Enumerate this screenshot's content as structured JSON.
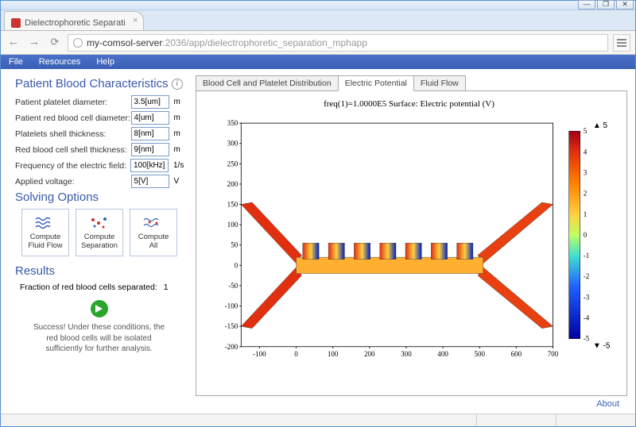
{
  "window": {
    "tab_title": "Dielectrophoretic Separati",
    "url_host": "my-comsol-server",
    "url_port": ":2036",
    "url_path": "/app/dielectrophoretic_separation_mphapp"
  },
  "menubar": [
    "File",
    "Resources",
    "Help"
  ],
  "sections": {
    "characteristics_title": "Patient Blood Characteristics",
    "solving_title": "Solving Options",
    "results_title": "Results"
  },
  "fields": [
    {
      "label": "Patient platelet diameter:",
      "value": "3.5[um]",
      "unit": "m"
    },
    {
      "label": "Patient red blood cell diameter:",
      "value": "4[um]",
      "unit": "m"
    },
    {
      "label": "Platelets shell thickness:",
      "value": "8[nm]",
      "unit": "m"
    },
    {
      "label": "Red blood cell shell thickness:",
      "value": "9[nm]",
      "unit": "m"
    },
    {
      "label": "Frequency of the electric field:",
      "value": "100[kHz]",
      "unit": "1/s"
    },
    {
      "label": "Applied voltage:",
      "value": "5[V]",
      "unit": "V"
    }
  ],
  "buttons": {
    "compute_fluid": "Compute\nFluid Flow",
    "compute_sep": "Compute\nSeparation",
    "compute_all": "Compute\nAll"
  },
  "results": {
    "fraction_label": "Fraction of red blood cells separated:",
    "fraction_value": "1",
    "message": "Success! Under these conditions, the red blood cells will be isolated sufficiently for further analysis."
  },
  "tabs": [
    "Blood Cell and Platelet Distribution",
    "Electric Potential",
    "Fluid Flow"
  ],
  "active_tab": 1,
  "about": "About",
  "chart_data": {
    "type": "heatmap",
    "title": "freq(1)=1.0000E5   Surface: Electric potential (V)",
    "xlabel": "",
    "ylabel": "",
    "xlim": [
      -150,
      700
    ],
    "ylim": [
      -200,
      350
    ],
    "xticks": [
      -100,
      0,
      100,
      200,
      300,
      400,
      500,
      600,
      700
    ],
    "yticks": [
      -200,
      -150,
      -100,
      -50,
      0,
      50,
      100,
      150,
      200,
      250,
      300,
      350
    ],
    "color_range": [
      -5,
      5
    ],
    "color_ticks": [
      5,
      4,
      3,
      2,
      1,
      0,
      -1,
      -2,
      -3,
      -4,
      -5
    ],
    "color_top_marker": "▲ 5",
    "color_bottom_marker": "▼ -5",
    "series": [
      {
        "name": "inlet-arm-top-left",
        "shape": "diagonal",
        "from": [
          -150,
          150
        ],
        "to": [
          0,
          10
        ],
        "potential": 5
      },
      {
        "name": "inlet-arm-bottom-left",
        "shape": "diagonal",
        "from": [
          -150,
          -150
        ],
        "to": [
          0,
          -10
        ],
        "potential": 5
      },
      {
        "name": "outlet-arm-top-right",
        "shape": "diagonal",
        "from": [
          500,
          10
        ],
        "to": [
          700,
          150
        ],
        "potential": 5
      },
      {
        "name": "outlet-arm-bottom-right",
        "shape": "diagonal",
        "from": [
          500,
          -10
        ],
        "to": [
          700,
          -150
        ],
        "potential": 5
      },
      {
        "name": "channel",
        "shape": "rect",
        "x": [
          0,
          500
        ],
        "y": [
          -15,
          15
        ],
        "potential_gradient": "5 to -5 periodic"
      },
      {
        "name": "electrode-wells",
        "shape": "rect-array",
        "x_centers": [
          40,
          110,
          180,
          250,
          320,
          390,
          460
        ],
        "y": [
          15,
          50
        ],
        "potential": -5
      }
    ]
  }
}
